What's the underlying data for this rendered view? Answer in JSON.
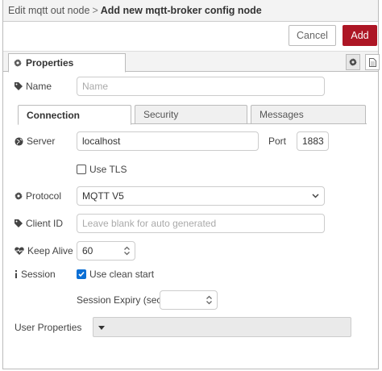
{
  "breadcrumb": {
    "parent": "Edit mqtt out node",
    "separator": ">",
    "current": "Add new mqtt-broker config node"
  },
  "toolbar": {
    "cancel_label": "Cancel",
    "add_label": "Add",
    "add_color": "#ad1625"
  },
  "tabs": {
    "properties_label": "Properties",
    "icons": [
      "gear-icon",
      "document-icon"
    ]
  },
  "name_field": {
    "label": "Name",
    "placeholder": "Name",
    "icon": "tag-icon"
  },
  "subtabs": [
    {
      "label": "Connection",
      "active": true
    },
    {
      "label": "Security",
      "active": false
    },
    {
      "label": "Messages",
      "active": false
    }
  ],
  "server": {
    "label": "Server",
    "value": "localhost",
    "port_label": "Port",
    "port_value": "1883",
    "icon": "globe-icon"
  },
  "tls": {
    "label": "Use TLS",
    "checked": false
  },
  "protocol": {
    "label": "Protocol",
    "value": "MQTT V5",
    "icon": "gear-icon"
  },
  "client_id": {
    "label": "Client ID",
    "placeholder": "Leave blank for auto generated",
    "icon": "tag-icon"
  },
  "keep_alive": {
    "label": "Keep Alive",
    "value": "60",
    "icon": "heartbeat-icon"
  },
  "session": {
    "label": "Session",
    "clean_start_label": "Use clean start",
    "clean_start_checked": true,
    "expiry_label": "Session Expiry (secs)",
    "expiry_value": "",
    "icon": "info-icon",
    "check_color": "#0b6fd5"
  },
  "user_properties": {
    "label": "User Properties"
  }
}
